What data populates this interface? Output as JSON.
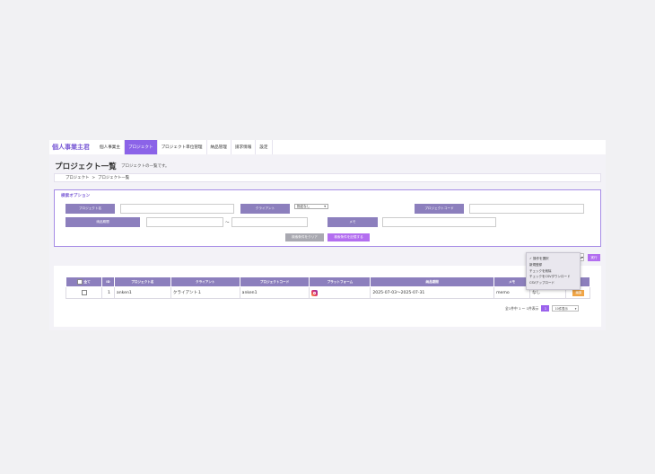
{
  "brand": "個人事業主君",
  "nav": [
    "個人事業主",
    "プロジェクト",
    "プロジェクト単位管理",
    "納品管理",
    "請求情報",
    "設定"
  ],
  "page": {
    "title": "プロジェクト一覧",
    "subtitle": "プロジェクトの一覧です。"
  },
  "breadcrumb": [
    "プロジェクト",
    ">",
    "プロジェクト一覧"
  ],
  "search": {
    "title": "検索オプション",
    "labels": {
      "project_name": "プロジェクト名",
      "client": "クライアント",
      "project_code": "プロジェクトコード",
      "delivery_date": "納品期間",
      "memo": "メモ"
    },
    "client_select": "指定なし",
    "tilde": "〜",
    "clear_button": "検索条件をクリア",
    "save_button": "検索条件を記憶する"
  },
  "bulk": {
    "options": [
      "✓ 操作を選択",
      "新規登録",
      "チェックを削除",
      "チェックをCSVダウンロード",
      "CSVアップロード"
    ],
    "run_button": "実行"
  },
  "table": {
    "headers": [
      "全て",
      "ID",
      "プロジェクト名",
      "クライアント",
      "プロジェクトコード",
      "プラットフォーム",
      "納品期間",
      "メモ",
      "",
      ""
    ],
    "rows": [
      {
        "id": "1",
        "name": "anken1",
        "client": "クライアント１",
        "code": "anken1",
        "platform": "instagram-icon",
        "period": "2025-07-03〜2025-07-31",
        "memo": "memo",
        "status": "なし",
        "edit": "編集"
      }
    ]
  },
  "pager": {
    "summary": "全1件中 1 〜 1件表示",
    "current": "1",
    "per_page": "10件表示"
  }
}
